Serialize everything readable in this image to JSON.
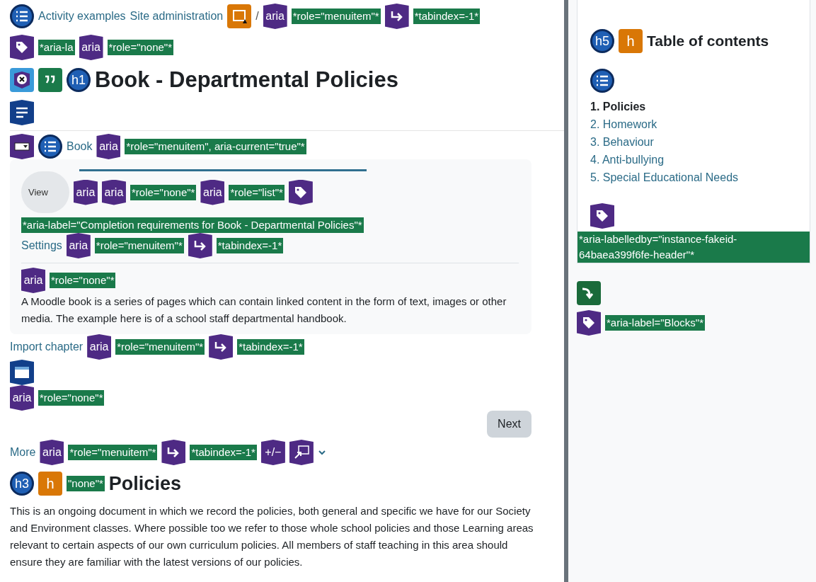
{
  "breadcrumb": [
    {
      "kind": "list-icon"
    },
    {
      "kind": "link",
      "text": "Activity examples"
    },
    {
      "kind": "link",
      "text": "Site administration"
    },
    {
      "kind": "alert-image"
    },
    {
      "kind": "text",
      "text": "/"
    },
    {
      "kind": "aria",
      "text": "aria"
    },
    {
      "kind": "note",
      "text": "*role=\"menuitem\"*"
    },
    {
      "kind": "tabindex"
    },
    {
      "kind": "note",
      "text": "*tabindex=-1*"
    }
  ],
  "label_row": [
    {
      "kind": "tag"
    },
    {
      "kind": "note",
      "text": "*aria-la"
    },
    {
      "kind": "aria",
      "text": "aria"
    },
    {
      "kind": "note",
      "text": "*role=\"none\"*"
    }
  ],
  "title_row": [
    {
      "kind": "contrast-error"
    },
    {
      "kind": "quote"
    },
    {
      "kind": "heading",
      "text": "h1"
    },
    {
      "kind": "title",
      "text": "Book - Departmental Policies"
    }
  ],
  "css_row": [
    {
      "kind": "css"
    }
  ],
  "nav_row": [
    {
      "kind": "select"
    },
    {
      "kind": "list-icon"
    },
    {
      "kind": "link",
      "text": "Book"
    },
    {
      "kind": "aria",
      "text": "aria"
    },
    {
      "kind": "note",
      "text": "*role=\"menuitem\", aria-current=\"true\"*"
    }
  ],
  "card": {
    "tab_row": [
      {
        "kind": "pill",
        "text": "View"
      },
      {
        "kind": "aria",
        "text": "aria"
      },
      {
        "kind": "aria",
        "text": "aria"
      },
      {
        "kind": "note",
        "text": "*role=\"none\"*"
      },
      {
        "kind": "aria",
        "text": "aria"
      },
      {
        "kind": "note",
        "text": "*role=\"list\"*"
      },
      {
        "kind": "tag"
      },
      {
        "kind": "note",
        "text": "*aria-label=\"Completion requirements for Book - Departmental Policies\"*"
      }
    ],
    "settings_row": [
      {
        "kind": "link",
        "text": "Settings"
      },
      {
        "kind": "aria",
        "text": "aria"
      },
      {
        "kind": "note",
        "text": "*role=\"menuitem\"*"
      },
      {
        "kind": "tabindex"
      },
      {
        "kind": "note",
        "text": "*tabindex=-1*"
      }
    ],
    "intro_row": [
      {
        "kind": "aria",
        "text": "aria"
      },
      {
        "kind": "note",
        "text": "*role=\"none\"*"
      }
    ],
    "intro": "A Moodle book is a series of pages which can contain linked content  in the form of text, images or other media. The example here is of a school staff departmental handbook."
  },
  "import_row": [
    {
      "kind": "link",
      "text": "Import chapter"
    },
    {
      "kind": "aria",
      "text": "aria"
    },
    {
      "kind": "note",
      "text": "*role=\"menuitem\"*"
    },
    {
      "kind": "tabindex"
    },
    {
      "kind": "note",
      "text": "*tabindex=-1*"
    }
  ],
  "window_row": [
    {
      "kind": "css-window"
    }
  ],
  "none_row": [
    {
      "kind": "aria",
      "text": "aria"
    },
    {
      "kind": "note",
      "text": "*role=\"none\"*"
    }
  ],
  "next_button": "Next",
  "more_row": [
    {
      "kind": "link",
      "text": "More"
    },
    {
      "kind": "aria",
      "text": "aria"
    },
    {
      "kind": "note",
      "text": "*role=\"menuitem\"*"
    },
    {
      "kind": "tabindex"
    },
    {
      "kind": "note",
      "text": "*tabindex=-1*"
    },
    {
      "kind": "plusminus",
      "text": "+/−"
    },
    {
      "kind": "popup"
    },
    {
      "kind": "chevron"
    }
  ],
  "chapter_row": [
    {
      "kind": "heading",
      "text": "h3"
    },
    {
      "kind": "empty-heading",
      "text": "h"
    },
    {
      "kind": "note",
      "text": "\"none\"*"
    },
    {
      "kind": "subtitle",
      "text": "Policies"
    }
  ],
  "chapter_text": "This is an ongoing document in which we record the policies, both general and specific we have for our Society and Environment classes. Where possible too we refer to those whole school policies and those Learning areas relevant to certain aspects of our own curriculum policies. All members of staff teaching in this area should ensure they are familiar with the latest versions of our policies.",
  "sidebar": {
    "heading_row": [
      {
        "kind": "heading",
        "text": "h5"
      },
      {
        "kind": "empty-heading",
        "text": "h"
      },
      {
        "kind": "toc-title",
        "text": "Table of contents"
      }
    ],
    "list_row": [
      {
        "kind": "list-icon"
      }
    ],
    "toc": [
      {
        "text": "1. Policies",
        "selected": true
      },
      {
        "text": "2. Homework",
        "selected": false
      },
      {
        "text": "3. Behaviour",
        "selected": false
      },
      {
        "text": "4. Anti-bullying",
        "selected": false
      },
      {
        "text": "5. Special Educational Needs",
        "selected": false
      }
    ],
    "tag_row": [
      {
        "kind": "tag"
      }
    ],
    "block_note": "*aria-labelledby=\"instance-fakeid-64baea399f6fe-header\"*",
    "skip_row": [
      {
        "kind": "skip"
      }
    ],
    "blocks_row": [
      {
        "kind": "tag"
      },
      {
        "kind": "note",
        "text": "*aria-label=\"Blocks\"*"
      }
    ]
  }
}
